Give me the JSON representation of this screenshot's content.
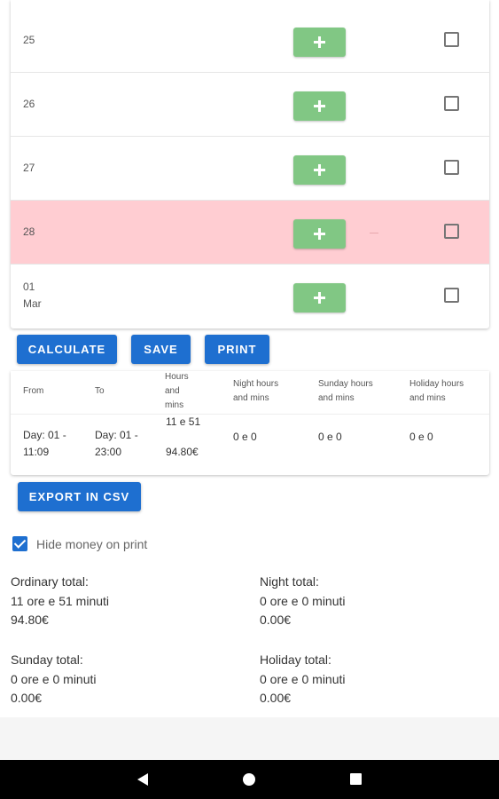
{
  "days": [
    {
      "label": "25",
      "holiday": false
    },
    {
      "label": "26",
      "holiday": false
    },
    {
      "label": "27",
      "holiday": false
    },
    {
      "label": "28",
      "holiday": true
    },
    {
      "label": "01\nMar",
      "holiday": false
    }
  ],
  "actions": {
    "calculate": "CALCULATE",
    "save": "SAVE",
    "print": "PRINT",
    "export_csv": "EXPORT IN CSV"
  },
  "results": {
    "headers": {
      "from": "From",
      "to": "To",
      "hours": "Hours\nand\nmins",
      "night": "Night hours\nand mins",
      "sunday": "Sunday hours\nand mins",
      "holiday": "Holiday hours\nand mins"
    },
    "row": {
      "from": "Day: 01 -\n11:09",
      "to": "Day: 01 -\n23:00",
      "hours": "11 e 51",
      "money": "94.80€",
      "night": "0 e 0",
      "sunday": "0 e 0",
      "holiday": "0 e 0"
    }
  },
  "hide_money_on_print": {
    "label": "Hide money on print",
    "checked": true
  },
  "totals": {
    "ordinary": {
      "title": "Ordinary total:",
      "time": "11 ore e 51 minuti",
      "money": "94.80€"
    },
    "night": {
      "title": "Night total:",
      "time": "0 ore e 0 minuti",
      "money": "0.00€"
    },
    "sunday": {
      "title": "Sunday total:",
      "time": "0 ore e 0 minuti",
      "money": "0.00€"
    },
    "holiday": {
      "title": "Holiday total:",
      "time": "0 ore e 0 minuti",
      "money": "0.00€"
    }
  },
  "colors": {
    "primary": "#1e6fd0",
    "add_button": "#81c784",
    "holiday_row": "#ffcdd2"
  },
  "icons": {
    "add": "plus-icon",
    "nav_back": "back-triangle-icon",
    "nav_home": "home-circle-icon",
    "nav_recent": "recent-square-icon"
  }
}
